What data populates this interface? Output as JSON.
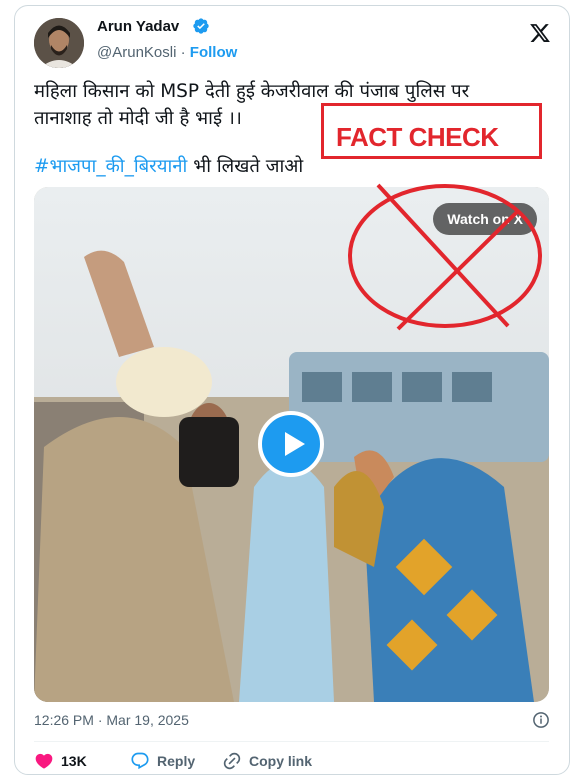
{
  "author": {
    "name": "Arun Yadav",
    "handle": "@ArunKosli",
    "separator": "·",
    "follow_label": "Follow"
  },
  "tweet": {
    "line1": "महिला किसान को MSP  देती हुई केजरीवाल की पंजाब पुलिस पर",
    "line2": "तानाशाह तो मोदी जी है भाई ।।",
    "hashtag": "#भाजपा_की_बिरयानी",
    "hashtag_suffix": " भी लिखते जाओ"
  },
  "media": {
    "watch_label": "Watch on X"
  },
  "overlay": {
    "fact_check_label": "FACT CHECK",
    "accent_color": "#e2262d"
  },
  "meta": {
    "timestamp": "12:26 PM · Mar 19, 2025"
  },
  "actions": {
    "like_count": "13K",
    "reply_label": "Reply",
    "copy_link_label": "Copy link"
  },
  "icons": [
    "verified-badge-icon",
    "x-logo-icon",
    "play-icon",
    "info-icon",
    "heart-icon",
    "reply-icon",
    "link-icon"
  ],
  "colors": {
    "link_blue": "#1d9bf0",
    "like_red": "#f91880",
    "muted_text": "#536471"
  }
}
